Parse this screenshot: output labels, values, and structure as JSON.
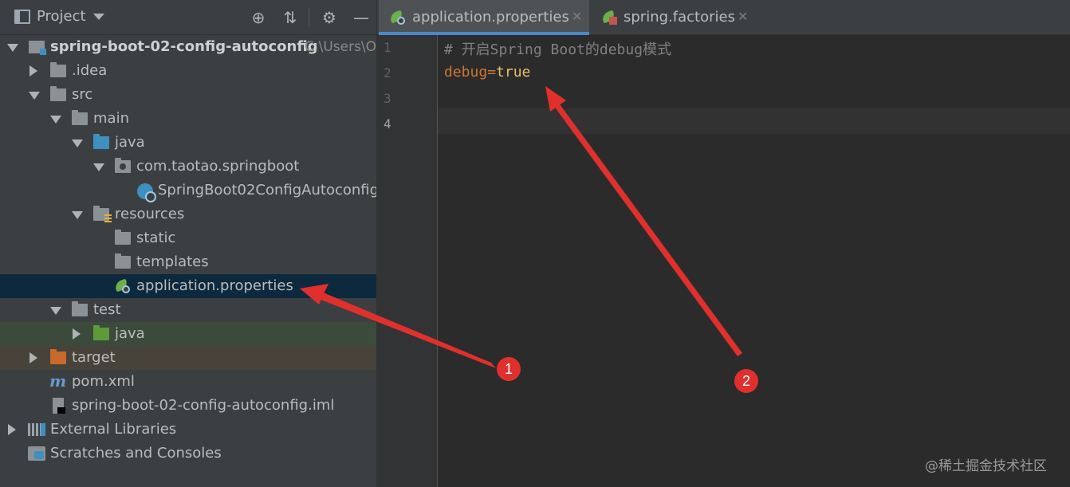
{
  "project_panel": {
    "title": "Project",
    "icons": [
      "project-icon",
      "caret-down-icon",
      "locate-icon",
      "collapse-all-icon",
      "gear-icon",
      "minimize-icon"
    ],
    "tree": [
      {
        "label": "spring-boot-02-config-autoconfig",
        "path": "C:\\Users\\O"
      },
      {
        "label": ".idea"
      },
      {
        "label": "src"
      },
      {
        "label": "main"
      },
      {
        "label": "java"
      },
      {
        "label": "com.taotao.springboot"
      },
      {
        "label": "SpringBoot02ConfigAutoconfig."
      },
      {
        "label": "resources"
      },
      {
        "label": "static"
      },
      {
        "label": "templates"
      },
      {
        "label": "application.properties"
      },
      {
        "label": "test"
      },
      {
        "label": "java"
      },
      {
        "label": "target"
      },
      {
        "label": "pom.xml"
      },
      {
        "label": "spring-boot-02-config-autoconfig.iml"
      },
      {
        "label": "External Libraries"
      },
      {
        "label": "Scratches and Consoles"
      }
    ]
  },
  "editor": {
    "tabs": [
      {
        "label": "application.properties",
        "active": true
      },
      {
        "label": "spring.factories",
        "active": false
      }
    ],
    "line_numbers": [
      "1",
      "2",
      "3",
      "4"
    ],
    "lines": {
      "l1_comment": "# 开启Spring Boot的debug模式",
      "l2_key": "debug",
      "l2_eq": "=",
      "l2_val": "true"
    }
  },
  "annotations": {
    "badge1": "1",
    "badge2": "2",
    "color": "#e0302d"
  },
  "watermark": "@稀土掘金技术社区",
  "colors": {
    "selection": "#0d293e",
    "tab_accent": "#4a88c7",
    "keyword": "#cc7832",
    "value": "#e8bf6a"
  }
}
